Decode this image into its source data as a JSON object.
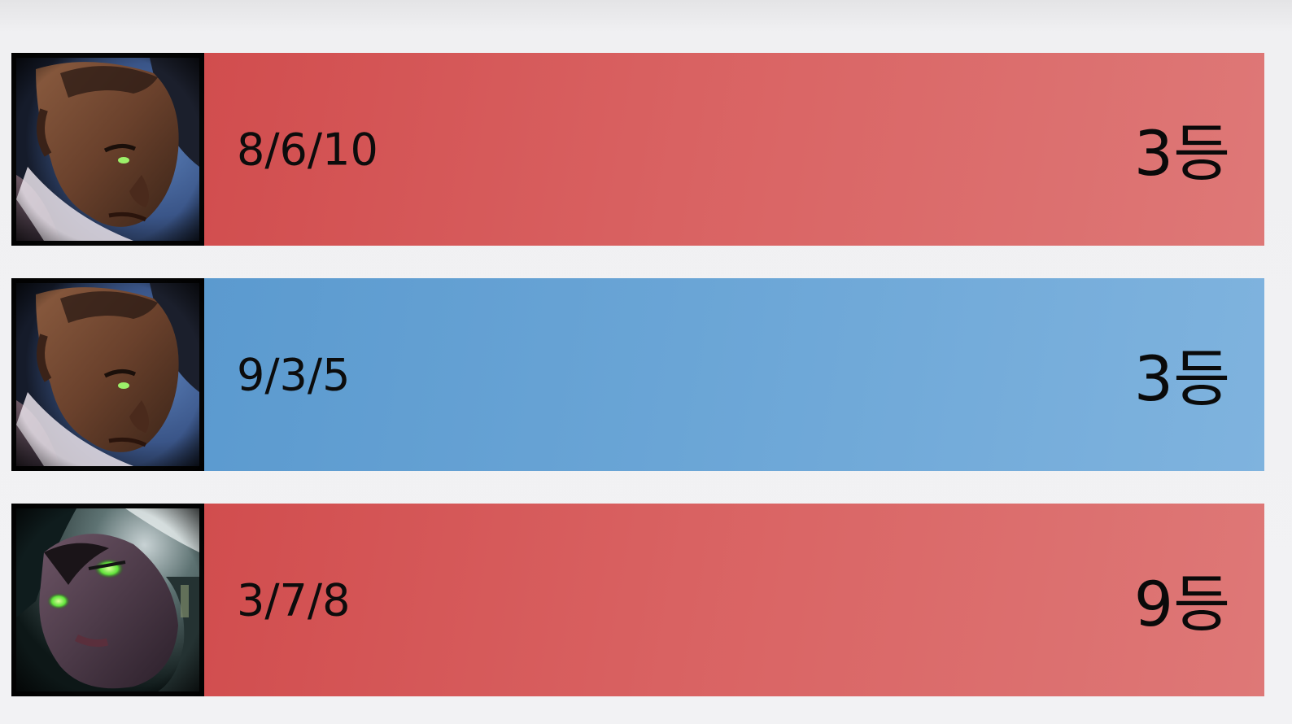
{
  "matches": [
    {
      "champion_icon": "lucian-portrait-icon",
      "result": "loss",
      "kda": "8/6/10",
      "rank": "3등",
      "bar_color": "#d65a5b"
    },
    {
      "champion_icon": "lucian-portrait-icon",
      "result": "win",
      "kda": "9/3/5",
      "rank": "3등",
      "bar_color": "#6aa5d6"
    },
    {
      "champion_icon": "senna-portrait-icon",
      "result": "loss",
      "kda": "3/7/8",
      "rank": "9등",
      "bar_color": "#d65a5b"
    }
  ]
}
